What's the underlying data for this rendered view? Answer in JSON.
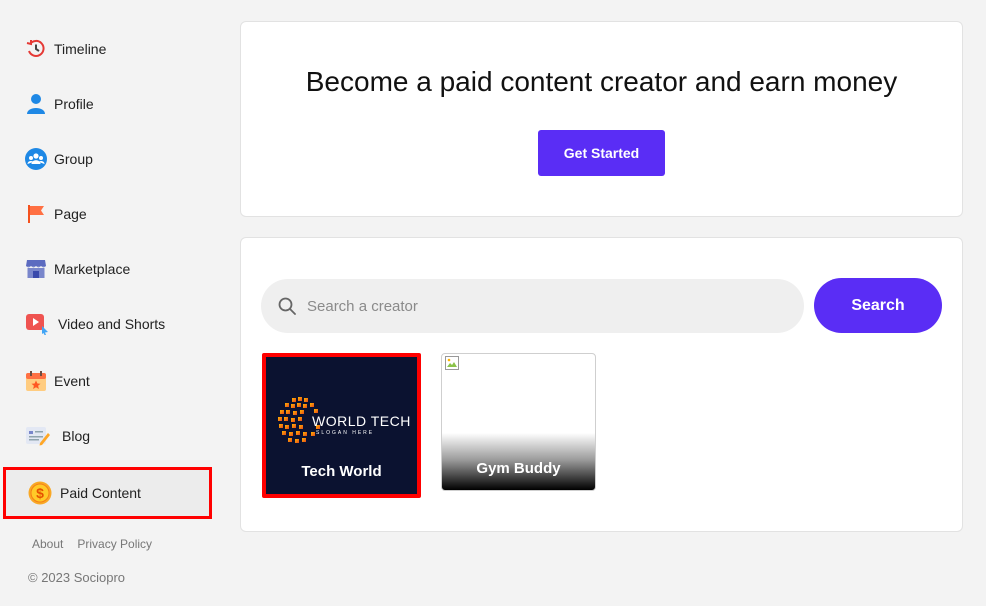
{
  "sidebar": {
    "items": [
      {
        "label": "Timeline",
        "icon": "timeline-icon"
      },
      {
        "label": "Profile",
        "icon": "profile-icon"
      },
      {
        "label": "Group",
        "icon": "group-icon"
      },
      {
        "label": "Page",
        "icon": "flag-icon"
      },
      {
        "label": "Marketplace",
        "icon": "store-icon"
      },
      {
        "label": "Video and Shorts",
        "icon": "video-icon"
      },
      {
        "label": "Event",
        "icon": "calendar-icon"
      },
      {
        "label": "Blog",
        "icon": "blog-icon"
      },
      {
        "label": "Paid Content",
        "icon": "dollar-coin-icon",
        "active": true
      }
    ],
    "footer_links": [
      "About",
      "Privacy Policy"
    ],
    "copyright": "© 2023 Sociopro"
  },
  "hero": {
    "title": "Become a paid content creator and earn money",
    "cta_label": "Get Started"
  },
  "search": {
    "placeholder": "Search a creator",
    "value": "",
    "button_label": "Search"
  },
  "creators": [
    {
      "name": "Tech World",
      "logo_text": "WORLD TECH",
      "logo_sub": "SLOGAN HERE",
      "highlighted": true
    },
    {
      "name": "Gym Buddy",
      "image": "broken-image-icon"
    }
  ],
  "colors": {
    "accent": "#5a2df5",
    "highlight": "#ff0000",
    "background": "#f3f3f3"
  }
}
